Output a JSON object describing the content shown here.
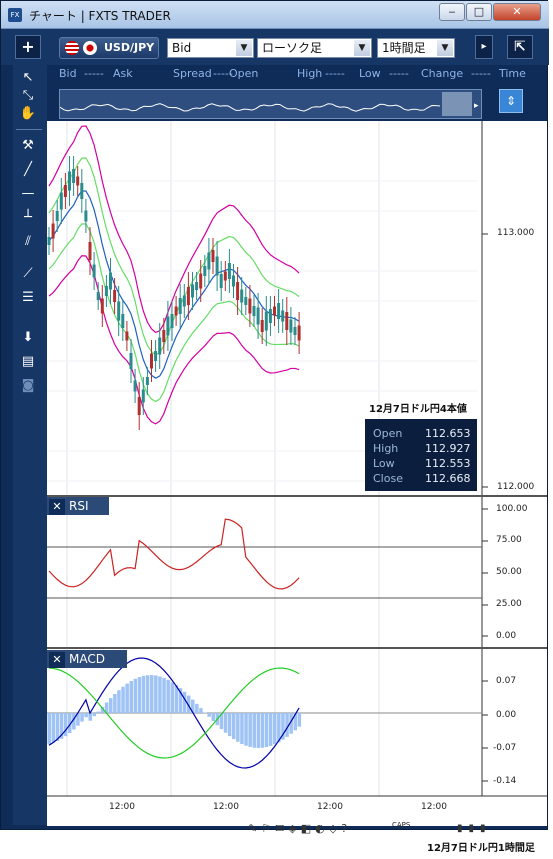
{
  "window": {
    "title": "チャート | FXTS TRADER",
    "app_icon": "FX"
  },
  "toolbar": {
    "add_label": "+",
    "pair": "USD/JPY",
    "price_type": "Bid",
    "chart_type": "ローソク足",
    "timeframe": "1時間足"
  },
  "quote_labels": [
    {
      "label": "Bid",
      "value": "-----"
    },
    {
      "label": "Ask",
      "value": ""
    },
    {
      "label": "Spread",
      "value": "-----"
    },
    {
      "label": "Open",
      "value": ""
    },
    {
      "label": "High",
      "value": "-----"
    },
    {
      "label": "Low",
      "value": "-----"
    },
    {
      "label": "Change",
      "value": "-----"
    },
    {
      "label": "Time",
      "value": ""
    }
  ],
  "price_axis": [
    "113.000",
    "112.000"
  ],
  "annotation": "12月7日ドル円4本値",
  "ohlc": [
    {
      "label": "Open",
      "value": "112.653"
    },
    {
      "label": "High",
      "value": "112.927"
    },
    {
      "label": "Low",
      "value": "112.553"
    },
    {
      "label": "Close",
      "value": "112.668"
    }
  ],
  "rsi": {
    "title": "RSI",
    "ticks": [
      "100.00",
      "75.00",
      "50.00",
      "25.00",
      "0.00"
    ]
  },
  "macd": {
    "title": "MACD",
    "ticks": [
      "0.07",
      "0.00",
      "-0.07",
      "-0.14"
    ]
  },
  "time_axis": [
    "12:00",
    "12:00",
    "12:00",
    "12:00"
  ],
  "status": {
    "caps": "CAPS",
    "caption": "12月7日ドル円1時間足"
  },
  "colors": {
    "frame": "#0f2b58",
    "candle_up": "#2a8c8c",
    "candle_down": "#b03030",
    "bb_outer": "#d400a0",
    "bb_inner": "#66dd66",
    "ma": "#2060c0",
    "rsi": "#cc2222",
    "macd": "#0000aa",
    "signal": "#22cc22",
    "hist": "#9fc3f5"
  }
}
